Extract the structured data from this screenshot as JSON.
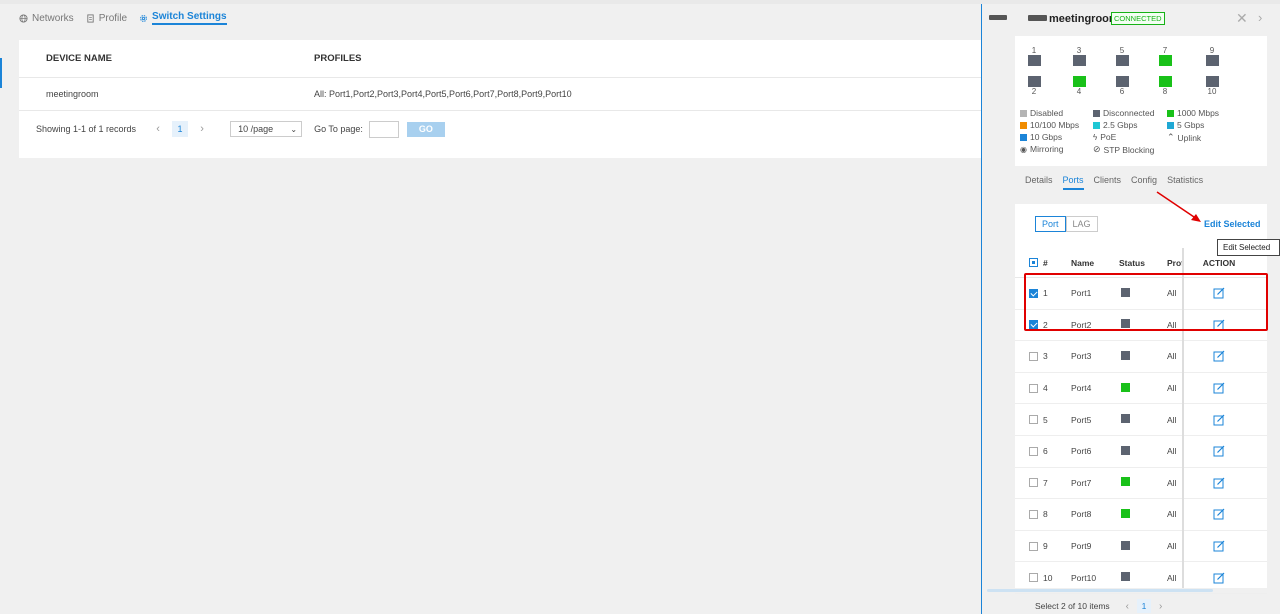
{
  "topnav": {
    "tabs": [
      {
        "label": "Networks",
        "icon": "globe-icon"
      },
      {
        "label": "Profile",
        "icon": "document-icon"
      },
      {
        "label": "Switch Settings",
        "icon": "gear-icon",
        "active": true
      }
    ]
  },
  "table": {
    "headers": [
      "DEVICE NAME",
      "PROFILES"
    ],
    "rows": [
      {
        "device": "meetingroom",
        "profiles": "All: Port1,Port2,Port3,Port4,Port5,Port6,Port7,Port8,Port9,Port10"
      }
    ]
  },
  "pager": {
    "summary": "Showing 1-1 of 1 records",
    "page": "1",
    "page_size": "10 /page",
    "goto_label": "Go To page:",
    "go_button": "GO"
  },
  "panel": {
    "device_name": "meetingroom",
    "status": "CONNECTED",
    "ports_top": [
      "1",
      "3",
      "5",
      "7",
      "9"
    ],
    "ports_bottom": [
      "2",
      "4",
      "6",
      "8",
      "10"
    ],
    "legend": {
      "disabled": "Disabled",
      "disconnected": "Disconnected",
      "mbps1000": "1000 Mbps",
      "mbps10_100": "10/100 Mbps",
      "gbps2_5": "2.5 Gbps",
      "gbps5": "5 Gbps",
      "gbps10": "10 Gbps",
      "poe": "PoE",
      "uplink": "Uplink",
      "mirroring": "Mirroring",
      "stp": "STP Blocking"
    },
    "tabs": [
      "Details",
      "Ports",
      "Clients",
      "Config",
      "Statistics"
    ],
    "active_tab": "Ports",
    "segment": [
      "Port",
      "LAG"
    ],
    "edit_selected": "Edit Selected",
    "tooltip": "Edit Selected",
    "columns": [
      "#",
      "Name",
      "Status",
      "Prof",
      "ACTION"
    ],
    "ports": [
      {
        "num": "1",
        "name": "Port1",
        "status": "gray",
        "profile": "All",
        "checked": true
      },
      {
        "num": "2",
        "name": "Port2",
        "status": "gray",
        "profile": "All",
        "checked": true
      },
      {
        "num": "3",
        "name": "Port3",
        "status": "gray",
        "profile": "All",
        "checked": false
      },
      {
        "num": "4",
        "name": "Port4",
        "status": "green",
        "profile": "All",
        "checked": false
      },
      {
        "num": "5",
        "name": "Port5",
        "status": "gray",
        "profile": "All",
        "checked": false
      },
      {
        "num": "6",
        "name": "Port6",
        "status": "gray",
        "profile": "All",
        "checked": false
      },
      {
        "num": "7",
        "name": "Port7",
        "status": "green",
        "profile": "All",
        "checked": false
      },
      {
        "num": "8",
        "name": "Port8",
        "status": "green",
        "profile": "All",
        "checked": false
      },
      {
        "num": "9",
        "name": "Port9",
        "status": "gray",
        "profile": "All",
        "checked": false
      },
      {
        "num": "10",
        "name": "Port10",
        "status": "gray",
        "profile": "All",
        "checked": false
      }
    ],
    "bottom_summary": "Select 2 of 10 items",
    "bottom_page": "1"
  },
  "colors": {
    "accent": "#1b84d8",
    "connected": "#17b217",
    "port_gray": "#5c6370",
    "port_green": "#19c119",
    "annotation_red": "#e00000"
  }
}
